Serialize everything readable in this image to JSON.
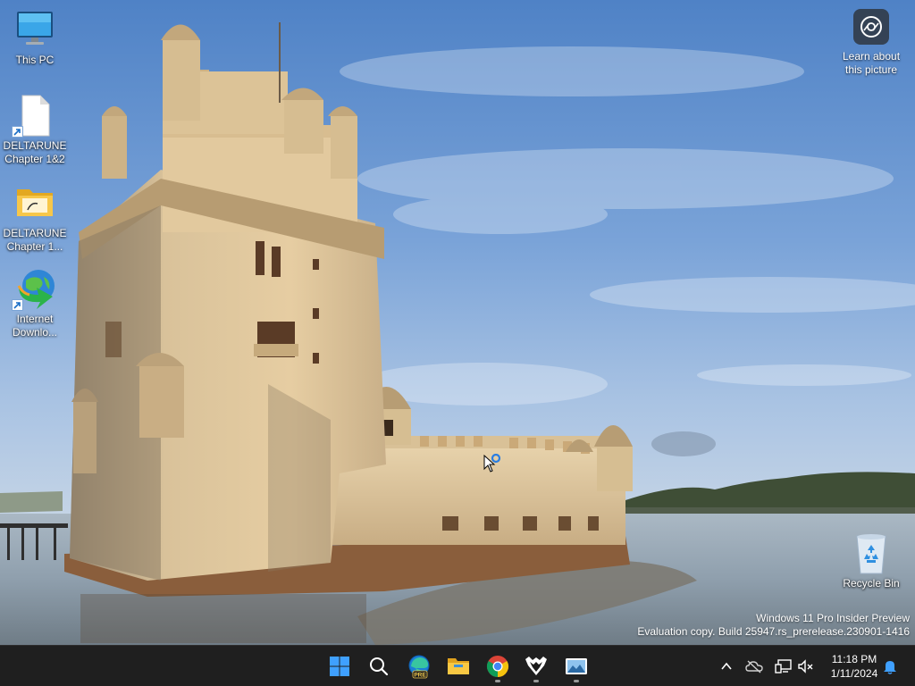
{
  "desktop": {
    "icons": [
      {
        "label": "This PC",
        "icon": "monitor-icon"
      },
      {
        "label": "DELTARUNE Chapter 1&2",
        "label_line1": "DELTARUNE",
        "label_line2": "Chapter 1&2",
        "icon": "blank-file-icon",
        "shortcut": true
      },
      {
        "label_line1": "DELTARUNE",
        "label_line2": "Chapter 1...",
        "icon": "folder-icon"
      },
      {
        "label_line1": "Internet",
        "label_line2": "Downlo...",
        "icon": "internet-download-manager-icon",
        "shortcut": true
      },
      {
        "label": "Recycle Bin",
        "icon": "recycle-bin-icon"
      }
    ],
    "learn_about_picture": {
      "line1": "Learn about",
      "line2": "this picture",
      "icon": "camera-lens-icon"
    },
    "watermark": {
      "line1": "Windows 11 Pro Insider Preview",
      "line2": "Evaluation copy. Build 25947.rs_prerelease.230901-1416"
    }
  },
  "taskbar": {
    "apps": [
      {
        "name": "Start",
        "icon": "windows-start-icon"
      },
      {
        "name": "Search",
        "icon": "search-icon"
      },
      {
        "name": "Microsoft Edge Preview",
        "icon": "edge-pre-icon",
        "badge": "PRE"
      },
      {
        "name": "File Explorer",
        "icon": "file-explorer-icon"
      },
      {
        "name": "Google Chrome",
        "icon": "chrome-icon",
        "running": true
      },
      {
        "name": "DELTARUNE",
        "icon": "deltarune-heart-icon",
        "running": true
      },
      {
        "name": "Photos",
        "icon": "photos-icon",
        "running": true
      }
    ],
    "tray": {
      "icons": [
        "chevron-up-icon",
        "onedrive-cloud-icon",
        "network-icon",
        "volume-muted-icon"
      ],
      "time": "11:18 PM",
      "date": "1/11/2024",
      "notification_icon": "bell-icon"
    }
  },
  "colors": {
    "taskbar_bg": "#1f1f1f",
    "accent_blue": "#0078d4",
    "sky_top": "#5f8fcf",
    "water": "#9aa9b6"
  }
}
